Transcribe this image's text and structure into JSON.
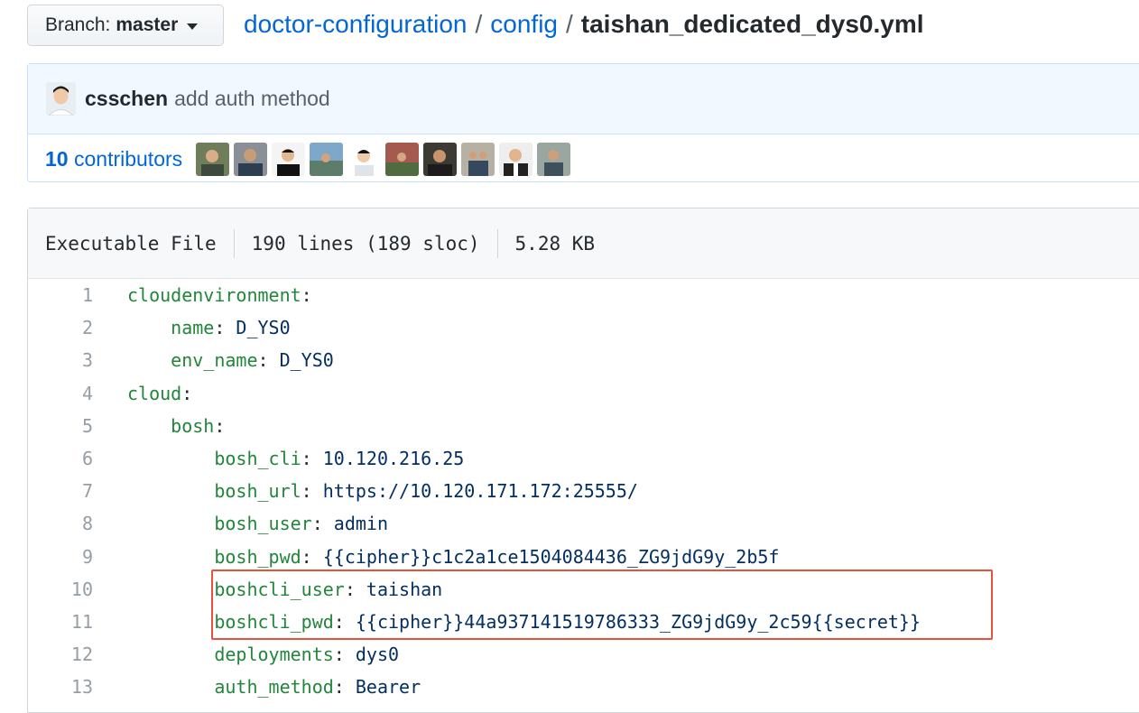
{
  "branch": {
    "label": "Branch:",
    "value": "master"
  },
  "breadcrumb": {
    "repo": "doctor-configuration",
    "folder": "config",
    "file": "taishan_dedicated_dys0.yml",
    "sep": "/"
  },
  "commit": {
    "author": "csschen",
    "message": "add auth method"
  },
  "contributors": {
    "count": "10",
    "label": "contributors"
  },
  "file_info": {
    "type": "Executable File",
    "lines": "190 lines (189 sloc)",
    "size": "5.28 KB"
  },
  "code_lines": [
    {
      "n": "1",
      "indent": "",
      "key": "cloudenvironment",
      "colon": ":",
      "value": ""
    },
    {
      "n": "2",
      "indent": "    ",
      "key": "name",
      "colon": ":",
      "value": " D_YS0"
    },
    {
      "n": "3",
      "indent": "    ",
      "key": "env_name",
      "colon": ":",
      "value": " D_YS0"
    },
    {
      "n": "4",
      "indent": "",
      "key": "cloud",
      "colon": ":",
      "value": ""
    },
    {
      "n": "5",
      "indent": "    ",
      "key": "bosh",
      "colon": ":",
      "value": ""
    },
    {
      "n": "6",
      "indent": "        ",
      "key": "bosh_cli",
      "colon": ":",
      "value": " 10.120.216.25"
    },
    {
      "n": "7",
      "indent": "        ",
      "key": "bosh_url",
      "colon": ":",
      "value": " https://10.120.171.172:25555/"
    },
    {
      "n": "8",
      "indent": "        ",
      "key": "bosh_user",
      "colon": ":",
      "value": " admin"
    },
    {
      "n": "9",
      "indent": "        ",
      "key": "bosh_pwd",
      "colon": ":",
      "value": " {{cipher}}c1c2a1ce1504084436_ZG9jdG9y_2b5f"
    },
    {
      "n": "10",
      "indent": "        ",
      "key": "boshcli_user",
      "colon": ":",
      "value": " taishan"
    },
    {
      "n": "11",
      "indent": "        ",
      "key": "boshcli_pwd",
      "colon": ":",
      "value": " {{cipher}}44a937141519786333_ZG9jdG9y_2c59{{secret}}"
    },
    {
      "n": "12",
      "indent": "        ",
      "key": "deployments",
      "colon": ":",
      "value": " dys0"
    },
    {
      "n": "13",
      "indent": "        ",
      "key": "auth_method",
      "colon": ":",
      "value": " Bearer"
    }
  ],
  "colors": {
    "link": "#0366d6",
    "yaml_key": "#22863a",
    "yaml_value": "#032f62",
    "highlight_border": "#e5533d"
  },
  "icons": {
    "caret": "caret-down-icon"
  }
}
